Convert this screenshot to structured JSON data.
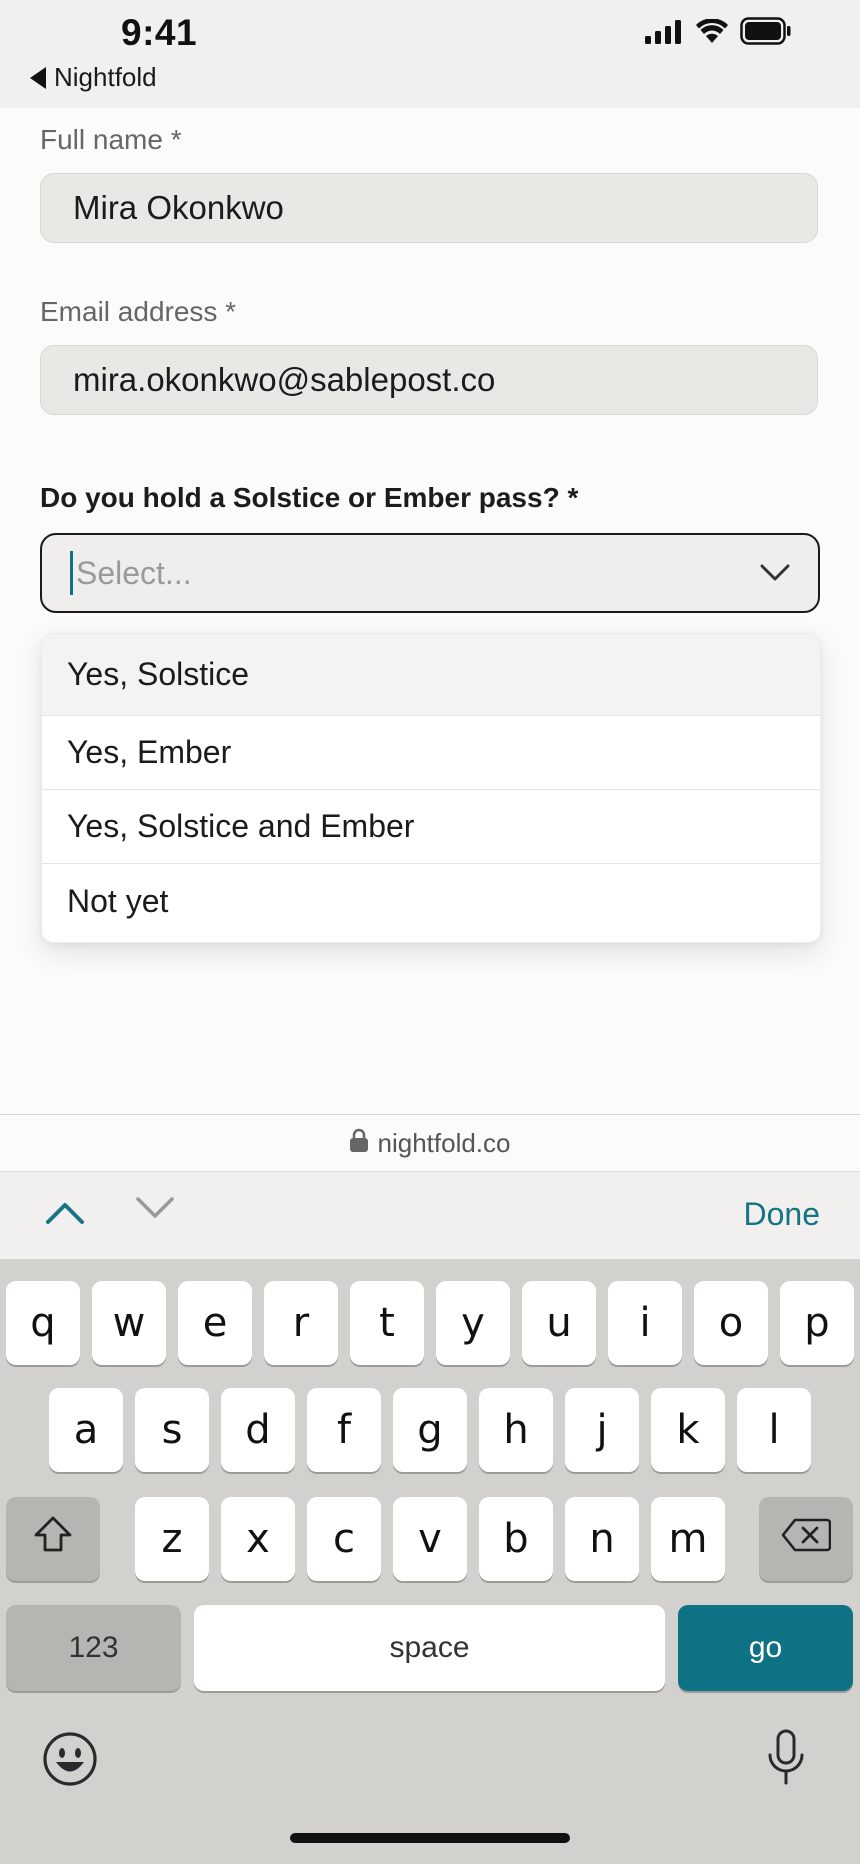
{
  "status": {
    "time": "9:41",
    "back_label": "Nightfold"
  },
  "form": {
    "full_name": {
      "label": "Full name *",
      "value": "Mira Okonkwo"
    },
    "email": {
      "label": "Email address *",
      "value": "mira.okonkwo@sablepost.co"
    },
    "pass": {
      "label": "Do you hold a Solstice or Ember pass? *",
      "placeholder": "Select..."
    },
    "options": [
      "Yes, Solstice",
      "Yes, Ember",
      "Yes, Solstice and Ember",
      "Not yet"
    ]
  },
  "url": "nightfold.co",
  "accessory": {
    "done_label": "Done"
  },
  "keyboard": {
    "row1": [
      "q",
      "w",
      "e",
      "r",
      "t",
      "y",
      "u",
      "i",
      "o",
      "p"
    ],
    "row2": [
      "a",
      "s",
      "d",
      "f",
      "g",
      "h",
      "j",
      "k",
      "l"
    ],
    "row3": [
      "z",
      "x",
      "c",
      "v",
      "b",
      "n",
      "m"
    ],
    "numbers_label": "123",
    "space_label": "space",
    "go_label": "go"
  },
  "colors": {
    "accent": "#0f7284",
    "keyboard_bg": "#d3d1ce"
  },
  "icons": [
    "back-arrow-icon",
    "signal-icon",
    "wifi-icon",
    "battery-icon",
    "chevron-down-icon",
    "lock-icon",
    "chevron-up-icon",
    "shift-icon",
    "delete-icon",
    "emoji-icon",
    "microphone-icon"
  ]
}
